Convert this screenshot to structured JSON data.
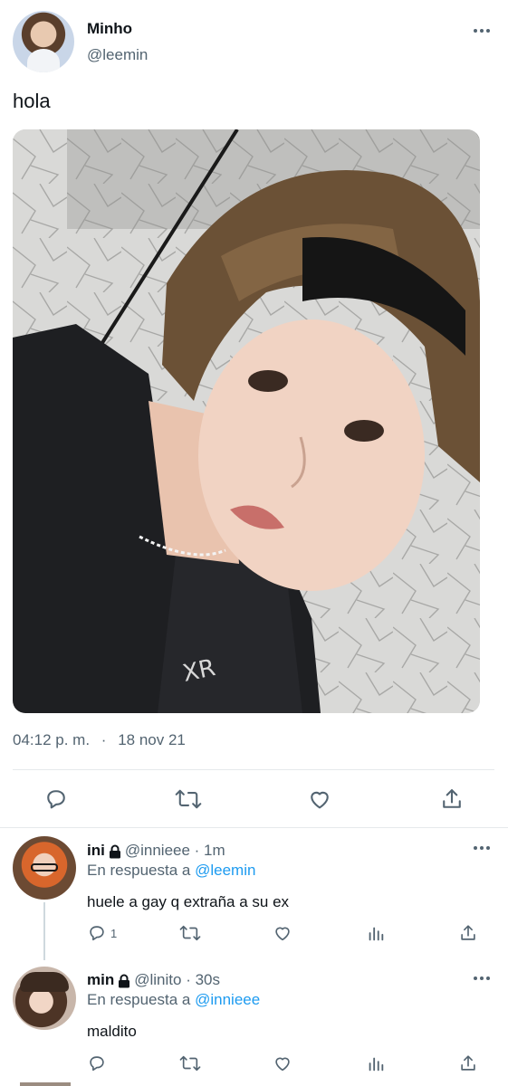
{
  "main_tweet": {
    "display_name": "Minho",
    "handle": "@leemin",
    "text": "hola",
    "time": "04:12 p. m.",
    "separator": "·",
    "date": "18 nov 21"
  },
  "replies": [
    {
      "display_name": "ini",
      "handle": "@innieee",
      "time": "· 1m",
      "reply_prefix": "En respuesta a",
      "reply_to": "@leemin",
      "text": "huele a gay q extraña a su ex",
      "reply_count": "1"
    },
    {
      "display_name": "min",
      "handle": "@linito",
      "time": "· 30s",
      "reply_prefix": "En respuesta a",
      "reply_to": "@innieee",
      "text": "maldito",
      "reply_count": ""
    }
  ],
  "icons": [
    "more-icon",
    "reply-icon",
    "retweet-icon",
    "like-icon",
    "share-icon",
    "analytics-icon",
    "lock-icon"
  ],
  "colors": {
    "accent": "#1d9bf0",
    "text": "#0f1419",
    "muted": "#536471",
    "divider": "#e6e9eb"
  }
}
